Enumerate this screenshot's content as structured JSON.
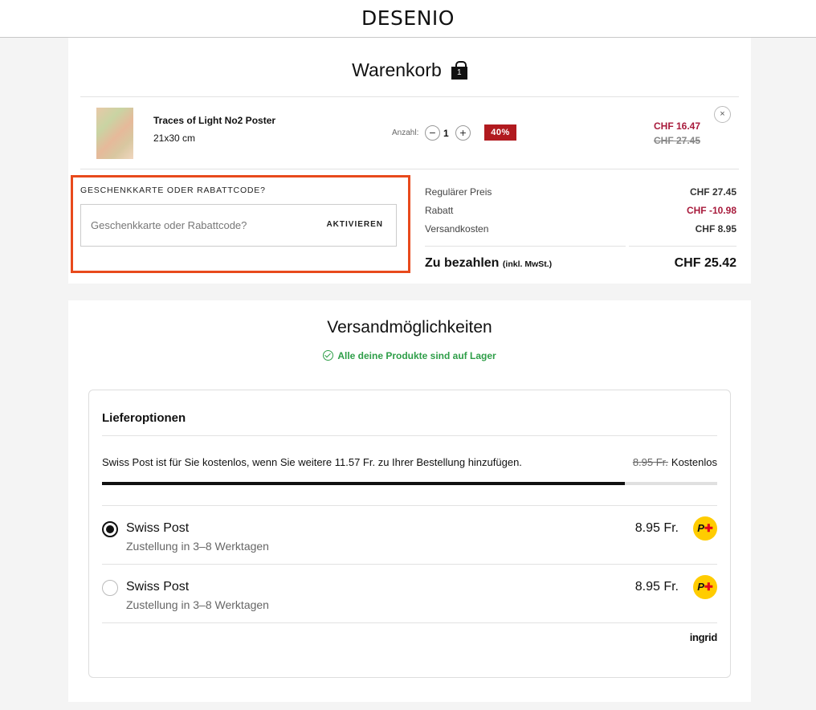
{
  "header": {
    "logo": "DESENIO"
  },
  "cart": {
    "title": "Warenkorb",
    "bag_count": "1",
    "item": {
      "name": "Traces of Light No2 Poster",
      "size": "21x30 cm",
      "qty_label": "Anzahl:",
      "qty_minus": "−",
      "qty_value": "1",
      "qty_plus": "+",
      "discount_badge": "40%",
      "price_new": "CHF 16.47",
      "price_old": "CHF 27.45",
      "remove": "×"
    },
    "gift": {
      "label": "GESCHENKKARTE ODER RABATTCODE?",
      "placeholder": "Geschenkkarte oder Rabattcode?",
      "activate": "AKTIVIEREN"
    },
    "summary": {
      "regular_label": "Regulärer Preis",
      "regular_value": "CHF 27.45",
      "discount_label": "Rabatt",
      "discount_value": "CHF -10.98",
      "shipping_label": "Versandkosten",
      "shipping_value": "CHF 8.95",
      "total_label": "Zu bezahlen",
      "total_note": "(inkl. MwSt.)",
      "total_value": "CHF 25.42"
    }
  },
  "shipping": {
    "title": "Versandmöglichkeiten",
    "stock_msg": "Alle deine Produkte sind auf Lager",
    "options_title": "Lieferoptionen",
    "free_msg": "Swiss Post ist für Sie kostenlos, wenn Sie weitere 11.57 Fr. zu Ihrer Bestellung hinzufügen.",
    "free_old_price": "8.95 Fr.",
    "free_label": "Kostenlos",
    "progress_fraction": 0.85,
    "options": [
      {
        "name": "Swiss Post",
        "sub": "Zustellung in 3–8 Werktagen",
        "price": "8.95 Fr.",
        "selected": true
      },
      {
        "name": "Swiss Post",
        "sub": "Zustellung in 3–8 Werktagen",
        "price": "8.95 Fr.",
        "selected": false
      }
    ],
    "provider": "ingrid"
  },
  "colors": {
    "accent_red": "#b11a1f",
    "price_red": "#a81b3c",
    "highlight_border": "#e84a1c",
    "stock_green": "#2e9e48",
    "post_yellow": "#ffcc00"
  },
  "icons": [
    "shopping-bag-icon",
    "close-icon",
    "check-circle-icon",
    "swiss-post-logo-icon"
  ]
}
